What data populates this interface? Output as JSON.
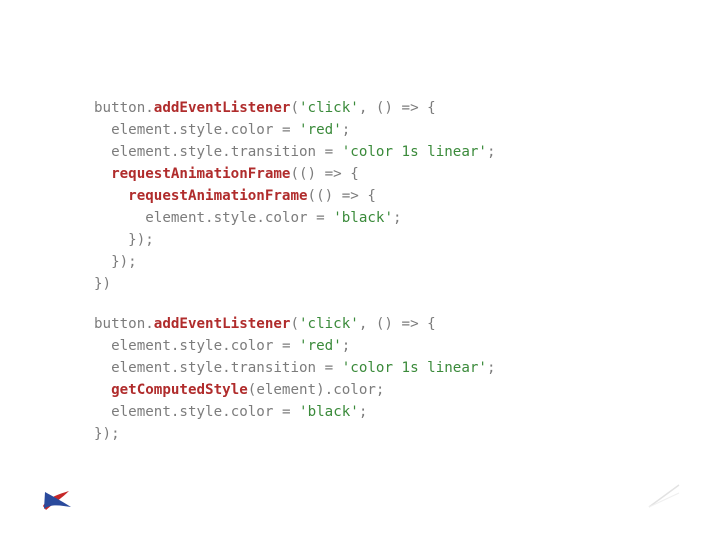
{
  "code_block_1": [
    [
      {
        "t": "button",
        "c": "id"
      },
      {
        "t": ".",
        "c": "punc"
      },
      {
        "t": "addEventListener",
        "c": "fn-bold"
      },
      {
        "t": "(",
        "c": "punc"
      },
      {
        "t": "'click'",
        "c": "str"
      },
      {
        "t": ", () ",
        "c": "punc"
      },
      {
        "t": "=>",
        "c": "punc"
      },
      {
        "t": " {",
        "c": "punc"
      }
    ],
    [
      {
        "t": "  element",
        "c": "id"
      },
      {
        "t": ".",
        "c": "punc"
      },
      {
        "t": "style",
        "c": "id"
      },
      {
        "t": ".",
        "c": "punc"
      },
      {
        "t": "color",
        "c": "id"
      },
      {
        "t": " = ",
        "c": "punc"
      },
      {
        "t": "'red'",
        "c": "str"
      },
      {
        "t": ";",
        "c": "punc"
      }
    ],
    [
      {
        "t": "  element",
        "c": "id"
      },
      {
        "t": ".",
        "c": "punc"
      },
      {
        "t": "style",
        "c": "id"
      },
      {
        "t": ".",
        "c": "punc"
      },
      {
        "t": "transition",
        "c": "id"
      },
      {
        "t": " = ",
        "c": "punc"
      },
      {
        "t": "'color 1s linear'",
        "c": "str"
      },
      {
        "t": ";",
        "c": "punc"
      }
    ],
    [
      {
        "t": "  ",
        "c": "punc"
      },
      {
        "t": "requestAnimationFrame",
        "c": "fn-bold"
      },
      {
        "t": "(() ",
        "c": "punc"
      },
      {
        "t": "=>",
        "c": "punc"
      },
      {
        "t": " {",
        "c": "punc"
      }
    ],
    [
      {
        "t": "    ",
        "c": "punc"
      },
      {
        "t": "requestAnimationFrame",
        "c": "fn-bold"
      },
      {
        "t": "(() ",
        "c": "punc"
      },
      {
        "t": "=>",
        "c": "punc"
      },
      {
        "t": " {",
        "c": "punc"
      }
    ],
    [
      {
        "t": "      element",
        "c": "id"
      },
      {
        "t": ".",
        "c": "punc"
      },
      {
        "t": "style",
        "c": "id"
      },
      {
        "t": ".",
        "c": "punc"
      },
      {
        "t": "color",
        "c": "id"
      },
      {
        "t": " = ",
        "c": "punc"
      },
      {
        "t": "'black'",
        "c": "str"
      },
      {
        "t": ";",
        "c": "punc"
      }
    ],
    [
      {
        "t": "    });",
        "c": "punc"
      }
    ],
    [
      {
        "t": "  });",
        "c": "punc"
      }
    ],
    [
      {
        "t": "})",
        "c": "punc"
      }
    ]
  ],
  "code_block_2": [
    [
      {
        "t": "button",
        "c": "id"
      },
      {
        "t": ".",
        "c": "punc"
      },
      {
        "t": "addEventListener",
        "c": "fn-bold"
      },
      {
        "t": "(",
        "c": "punc"
      },
      {
        "t": "'click'",
        "c": "str"
      },
      {
        "t": ", () ",
        "c": "punc"
      },
      {
        "t": "=>",
        "c": "punc"
      },
      {
        "t": " {",
        "c": "punc"
      }
    ],
    [
      {
        "t": "  element",
        "c": "id"
      },
      {
        "t": ".",
        "c": "punc"
      },
      {
        "t": "style",
        "c": "id"
      },
      {
        "t": ".",
        "c": "punc"
      },
      {
        "t": "color",
        "c": "id"
      },
      {
        "t": " = ",
        "c": "punc"
      },
      {
        "t": "'red'",
        "c": "str"
      },
      {
        "t": ";",
        "c": "punc"
      }
    ],
    [
      {
        "t": "  element",
        "c": "id"
      },
      {
        "t": ".",
        "c": "punc"
      },
      {
        "t": "style",
        "c": "id"
      },
      {
        "t": ".",
        "c": "punc"
      },
      {
        "t": "transition",
        "c": "id"
      },
      {
        "t": " = ",
        "c": "punc"
      },
      {
        "t": "'color 1s linear'",
        "c": "str"
      },
      {
        "t": ";",
        "c": "punc"
      }
    ],
    [
      {
        "t": "  ",
        "c": "punc"
      },
      {
        "t": "getComputedStyle",
        "c": "fn-bold"
      },
      {
        "t": "(",
        "c": "punc"
      },
      {
        "t": "element",
        "c": "id"
      },
      {
        "t": ")",
        "c": "punc"
      },
      {
        "t": ".",
        "c": "punc"
      },
      {
        "t": "color",
        "c": "id"
      },
      {
        "t": ";",
        "c": "punc"
      }
    ],
    [
      {
        "t": "  element",
        "c": "id"
      },
      {
        "t": ".",
        "c": "punc"
      },
      {
        "t": "style",
        "c": "id"
      },
      {
        "t": ".",
        "c": "punc"
      },
      {
        "t": "color",
        "c": "id"
      },
      {
        "t": " = ",
        "c": "punc"
      },
      {
        "t": "'black'",
        "c": "str"
      },
      {
        "t": ";",
        "c": "punc"
      }
    ],
    [
      {
        "t": "});",
        "c": "punc"
      }
    ]
  ],
  "logo_colors": {
    "red": "#c62828",
    "blue": "#2a4a9c"
  },
  "corner_color": "#e6e6e6"
}
